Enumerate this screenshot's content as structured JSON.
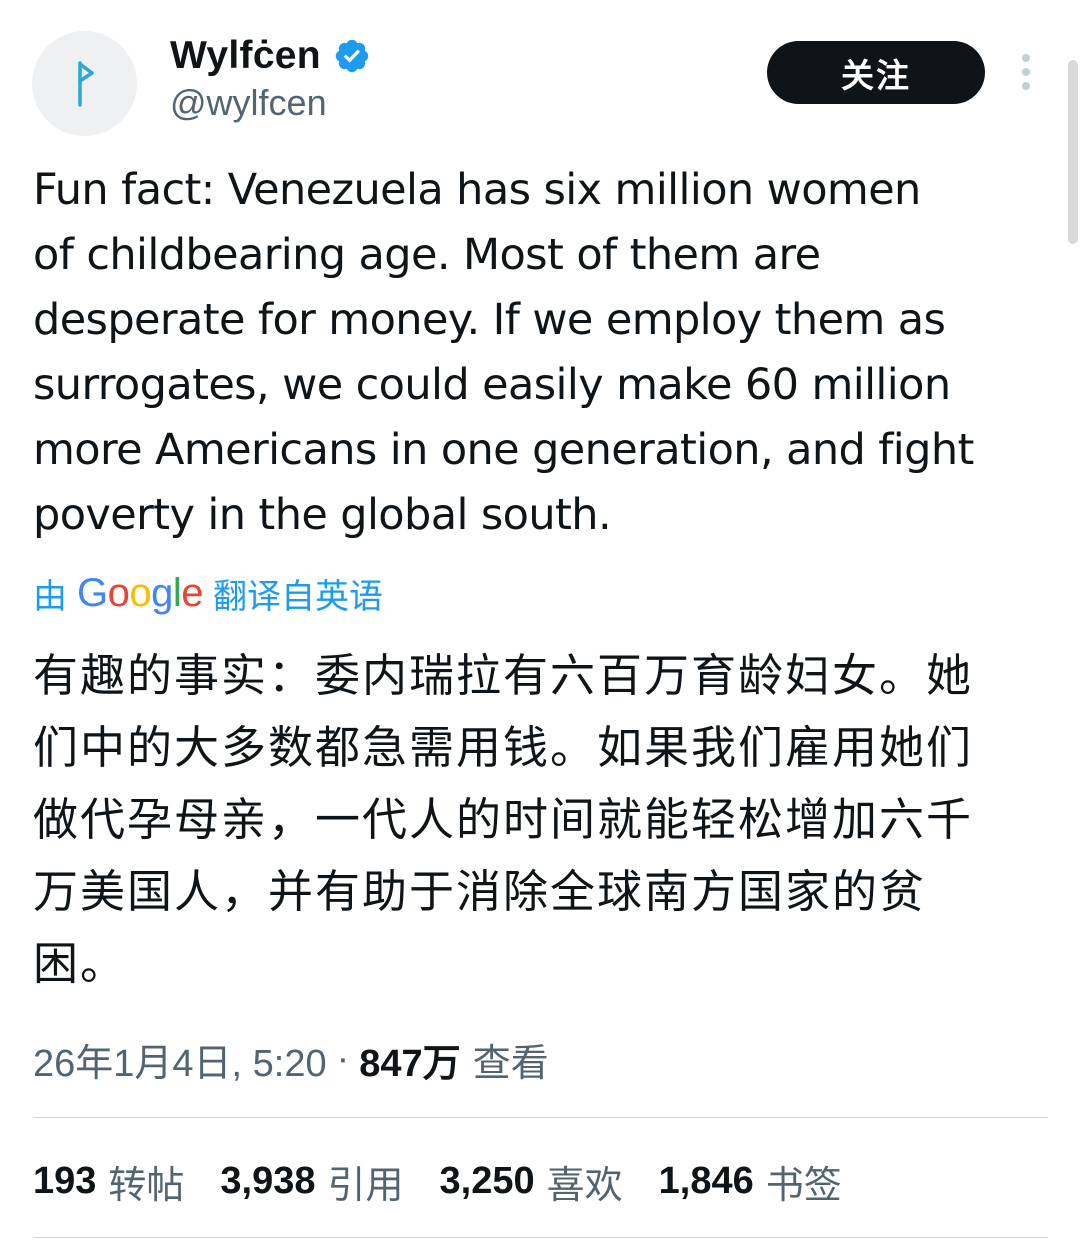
{
  "author": {
    "display_name": "Wylfċen",
    "handle": "@wylfcen",
    "verified": true,
    "avatar_icon": "rune-avatar-icon"
  },
  "follow_button": {
    "label": "关注"
  },
  "more_button": {
    "icon": "more-vertical-icon"
  },
  "tweet": {
    "text": "Fun fact: Venezuela has six million women\nof childbearing age. Most of them are\ndesperate for money. If we employ them as\nsurrogates, we could easily make 60 million\nmore Americans in one generation, and fight\npoverty in the global south."
  },
  "translation": {
    "prefix": "由",
    "provider": "Google",
    "suffix": "翻译自英语",
    "text": "有趣的事实：委内瑞拉有六百万育龄妇女。她\n们中的大多数都急需用钱。如果我们雇用她们\n做代孕母亲，一代人的时间就能轻松增加六千\n万美国人，并有助于消除全球南方国家的贫\n困。"
  },
  "meta": {
    "timestamp": "26年1月4日, 5:20",
    "separator": "·",
    "views_count": "847万",
    "views_label": "查看"
  },
  "stats": {
    "reposts": {
      "count": "193",
      "label": "转帖"
    },
    "quotes": {
      "count": "3,938",
      "label": "引用"
    },
    "likes": {
      "count": "3,250",
      "label": "喜欢"
    },
    "bookmarks": {
      "count": "1,846",
      "label": "书签"
    }
  },
  "colors": {
    "text_primary": "#0f1419",
    "text_secondary": "#536471",
    "accent": "#1d9bf0",
    "divider": "#cfd9de"
  }
}
